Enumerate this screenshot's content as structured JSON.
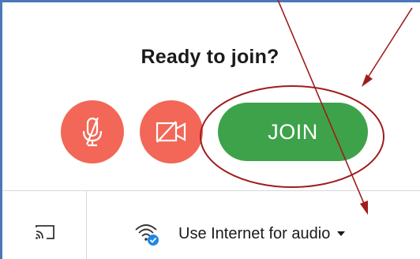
{
  "dialog": {
    "title": "Ready to join?"
  },
  "controls": {
    "mute_icon": "mic-off-icon",
    "video_icon": "video-off-icon",
    "join_label": "JOIN",
    "mute_color": "#f26757",
    "join_color": "#3ea24a"
  },
  "footer": {
    "cast_icon": "cast-icon",
    "audio_icon": "wifi-audio-icon",
    "audio_label": "Use Internet for audio",
    "audio_dropdown_icon": "caret-down-icon"
  },
  "annotation": {
    "color": "#a01c1c"
  }
}
